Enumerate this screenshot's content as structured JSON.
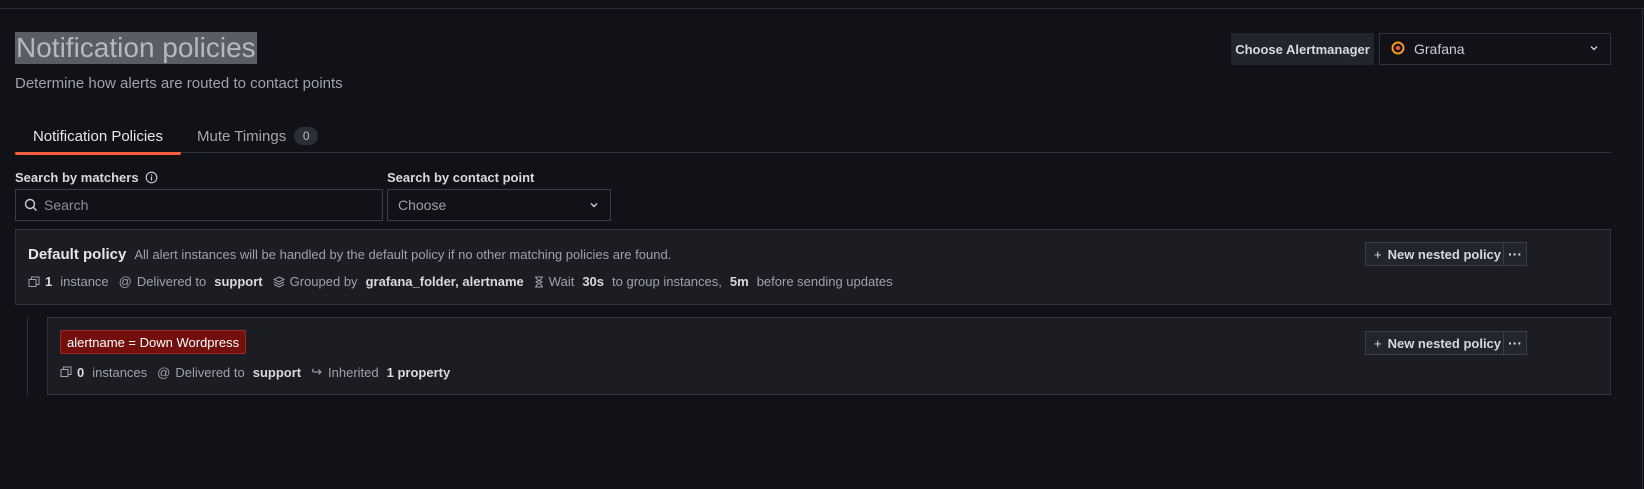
{
  "header": {
    "title": "Notification policies",
    "subtitle": "Determine how alerts are routed to contact points"
  },
  "alertmanager": {
    "label": "Choose Alertmanager",
    "selected": "Grafana",
    "icon": "grafana-logo-icon"
  },
  "tabs": [
    {
      "label": "Notification Policies",
      "active": true
    },
    {
      "label": "Mute Timings",
      "count": "0",
      "active": false
    }
  ],
  "filters": {
    "matchers_label": "Search by matchers",
    "matchers_placeholder": "Search",
    "contact_label": "Search by contact point",
    "contact_value": "Choose"
  },
  "default_policy": {
    "title": "Default policy",
    "description": "All alert instances will be handled by the default policy if no other matching policies are found.",
    "instance_count": "1",
    "instance_label": "instance",
    "delivered_prefix": "Delivered to",
    "contact_point": "support",
    "grouped_prefix": "Grouped by",
    "grouped_by": "grafana_folder, alertname",
    "wait_prefix": "Wait",
    "group_wait": "30s",
    "wait_mid": "to group instances,",
    "group_interval": "5m",
    "wait_suffix": "before sending updates",
    "new_nested_label": "New nested policy",
    "more_label": "···"
  },
  "child_policy": {
    "matcher": "alertname = Down Wordpress",
    "instance_count": "0",
    "instance_label": "instances",
    "delivered_prefix": "Delivered to",
    "contact_point": "support",
    "inherited_prefix": "Inherited",
    "inherited_value": "1 property",
    "new_nested_label": "New nested policy",
    "more_label": "···"
  },
  "colors": {
    "background": "#111217",
    "accent": "#f55f3e",
    "matcher_bg": "#73100d"
  }
}
